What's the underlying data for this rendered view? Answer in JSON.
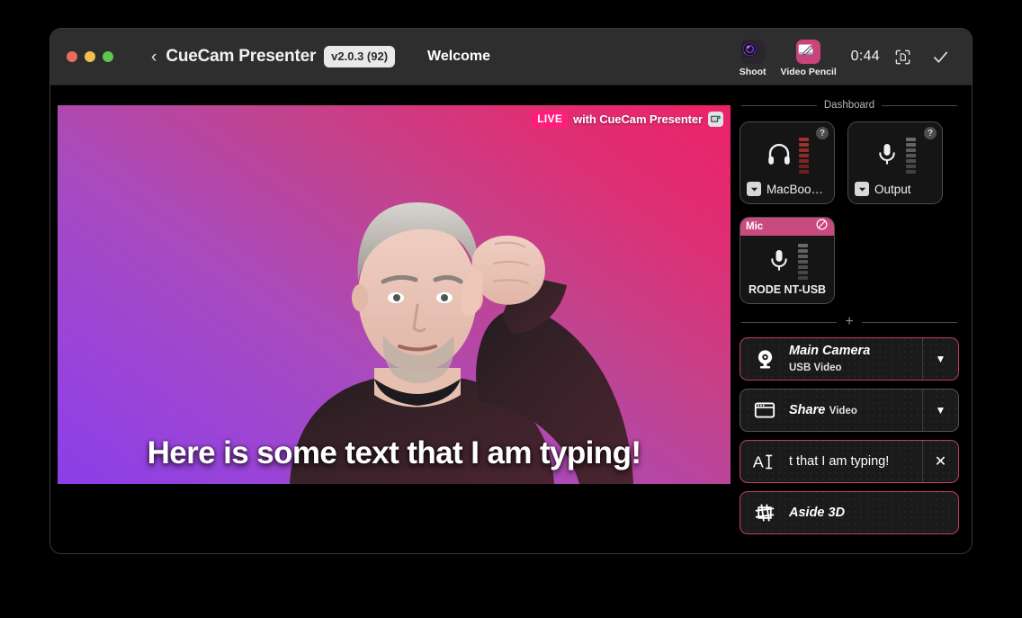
{
  "titlebar": {
    "back_icon": "chevron-left-icon",
    "app_name": "CueCam Presenter",
    "version": "v2.0.3 (92)",
    "document_title": "Welcome",
    "apps": [
      {
        "label": "Shoot",
        "icon": "camera-lens-icon"
      },
      {
        "label": "Video Pencil",
        "icon": "pencil-canvas-icon"
      }
    ],
    "timer": "0:44",
    "scan_icon": "document-scan-icon",
    "confirm_icon": "checkmark-icon"
  },
  "video": {
    "live_label": "LIVE",
    "live_suffix": "with CueCam Presenter",
    "app_icon": "cuecam-app-icon",
    "caption": "Here is some text that I am typing!",
    "gradient_from": "#8b3fe8",
    "gradient_to": "#ec2268"
  },
  "dashboard": {
    "section_label": "Dashboard",
    "io_cards": [
      {
        "name": "MacBook…",
        "icon": "headphones-icon",
        "help": "?",
        "meter_color": "#8e2b2b",
        "meter_levels": 7
      },
      {
        "name": "Output",
        "icon": "microphone-icon",
        "help": "?",
        "meter_color": "#595959",
        "meter_levels": 7
      }
    ],
    "mic_card": {
      "header_label": "Mic",
      "header_color": "#c94a7e",
      "mute_icon": "mic-muted-slash-icon",
      "icon": "microphone-icon",
      "device_name": "RODE NT-USB",
      "meter_color": "#595959",
      "meter_levels": 7
    },
    "add_label": "+",
    "sources": [
      {
        "title": "Main Camera",
        "subtitle": "USB Video",
        "icon": "webcam-icon",
        "action": "chevron-down-icon",
        "action_glyph": "▼",
        "border": "pink"
      },
      {
        "title": "Share",
        "subtitle": "Video",
        "icon": "window-share-icon",
        "action": "chevron-down-icon",
        "action_glyph": "▼",
        "border": "gray"
      },
      {
        "title": "t that I am typing!",
        "subtitle": "",
        "icon": "text-cursor-icon",
        "action": "close-icon",
        "action_glyph": "✕",
        "border": "pink"
      },
      {
        "title": "Aside 3D",
        "subtitle": "",
        "icon": "cube-3d-icon",
        "action": "",
        "action_glyph": "",
        "border": "pink"
      }
    ]
  }
}
